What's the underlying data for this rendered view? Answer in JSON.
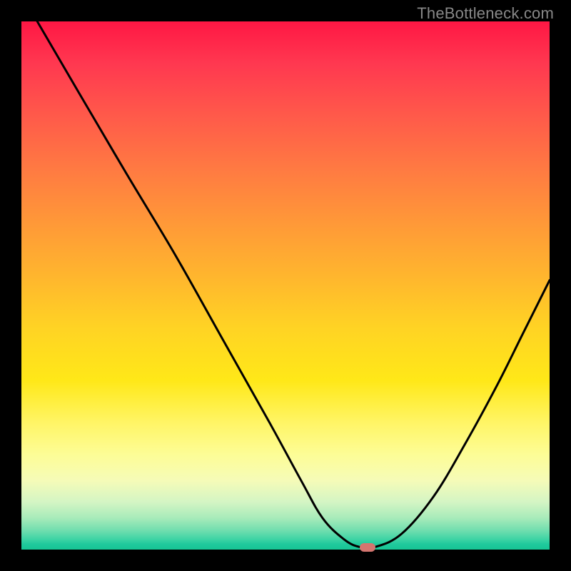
{
  "watermark": "TheBottleneck.com",
  "chart_data": {
    "type": "line",
    "title": "",
    "xlabel": "",
    "ylabel": "",
    "xlim": [
      0,
      100
    ],
    "ylim": [
      0,
      100
    ],
    "x": [
      3,
      10,
      20,
      29,
      38,
      47,
      53,
      57,
      61,
      64,
      67,
      72,
      78,
      84,
      90,
      95,
      100
    ],
    "values": [
      100,
      88,
      71,
      56,
      40,
      24,
      13,
      6,
      2,
      0.5,
      0.5,
      3,
      10,
      20,
      31,
      41,
      51
    ],
    "marker": {
      "x": 65.5,
      "y": 0.4
    },
    "background_gradient": {
      "top": "#ff1744",
      "mid": "#ffd324",
      "bottom": "#17c595"
    }
  }
}
